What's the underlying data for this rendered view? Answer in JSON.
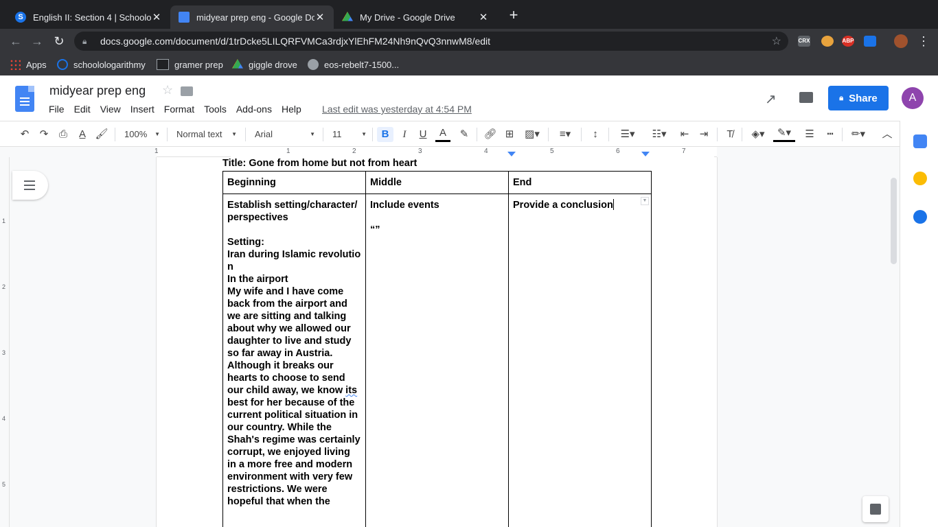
{
  "browser": {
    "tabs": [
      {
        "title": "English II: Section 4 | Schoolog",
        "favicon": "S",
        "active": false
      },
      {
        "title": "midyear prep eng - Google Doc",
        "favicon": "docs",
        "active": true
      },
      {
        "title": "My Drive - Google Drive",
        "favicon": "drive",
        "active": false
      }
    ],
    "new_tab": "+",
    "url": "docs.google.com/document/d/1trDcke5LILQRFVMCa3rdjxYlEhFM24Nh9nQvQ3nnwM8/edit",
    "extensions": [
      "CRX",
      "ABP"
    ],
    "bookmarks": [
      {
        "label": "Apps"
      },
      {
        "label": "schoolologarithmy"
      },
      {
        "label": "gramer prep"
      },
      {
        "label": "giggle drove"
      },
      {
        "label": "eos-rebelt7-1500..."
      }
    ]
  },
  "docs": {
    "title": "midyear prep eng",
    "menu": [
      "File",
      "Edit",
      "View",
      "Insert",
      "Format",
      "Tools",
      "Add-ons",
      "Help"
    ],
    "last_edit": "Last edit was yesterday at 4:54 PM",
    "share_label": "Share",
    "avatar_letter": "A",
    "toolbar": {
      "zoom": "100%",
      "style": "Normal text",
      "font": "Arial",
      "size": "11"
    },
    "ruler_numbers": [
      "1",
      "1",
      "2",
      "3",
      "4",
      "5",
      "6",
      "7"
    ],
    "vruler_numbers": [
      "1",
      "2",
      "3",
      "4",
      "5"
    ]
  },
  "document": {
    "title_line": "Title: Gone from home but not from heart",
    "table_headers": [
      "Beginning",
      "Middle",
      "End"
    ],
    "beginning": {
      "p1": "Establish setting/character/perspectives",
      "setting_label": "Setting:",
      "setting_1": "Iran during Islamic revolution",
      "setting_2": "In the airport",
      "body_pre": "My wife and I have come back from the airport and we are sitting and talking about why we allowed our daughter to live and study so far away in Austria. Although it breaks our hearts to choose to send our child away, we know ",
      "body_squig": "its",
      "body_post": " best for her because of the current political situation in our country. While the Shah's regime was certainly corrupt, we enjoyed living in a more free and modern environment with very few restrictions. We were hopeful that when the"
    },
    "middle": {
      "p1": "Include events",
      "p2": "“”"
    },
    "end": {
      "p1": "Provide a conclusion"
    }
  }
}
